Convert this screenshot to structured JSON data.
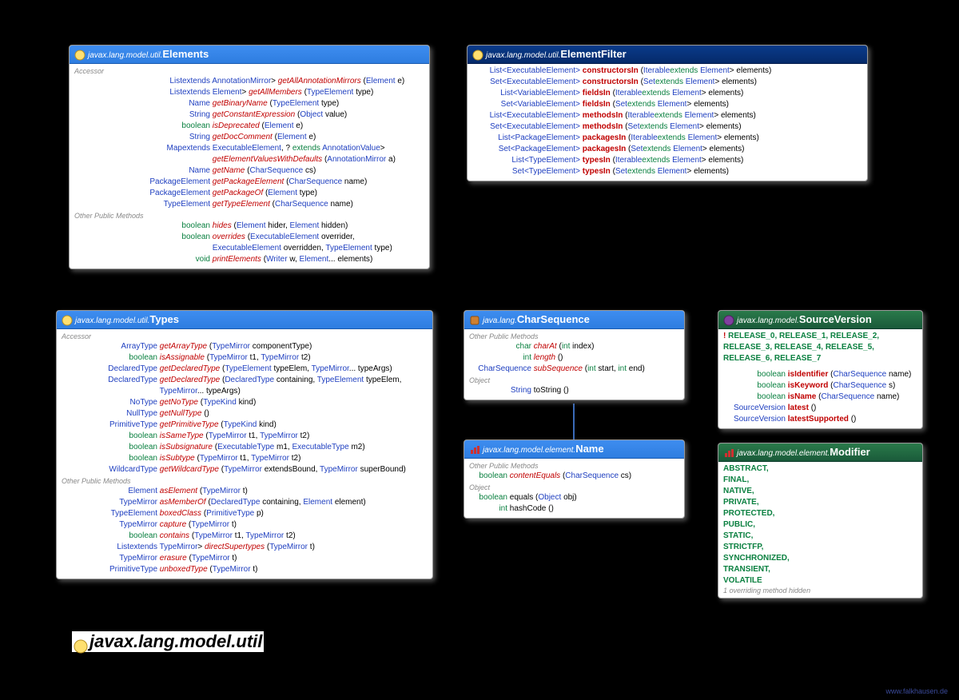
{
  "title": {
    "pkg": "javax.lang.model.util"
  },
  "credit": "www.falkhausen.de",
  "elements": {
    "pkg": "javax.lang.model.util.",
    "cls": "Elements",
    "sec1": "Accessor",
    "rows1": [
      {
        "ret": "List<? extends AnnotationMirror>",
        "mth": "getAllAnnotationMirrors",
        "args": "(Element e)"
      },
      {
        "ret": "List<? extends Element>",
        "mth": "getAllMembers",
        "args": "(TypeElement type)"
      },
      {
        "ret": "Name",
        "mth": "getBinaryName",
        "args": "(TypeElement type)"
      },
      {
        "ret": "String",
        "mth": "getConstantExpression",
        "args": "(Object value)"
      },
      {
        "ret": "boolean",
        "retkw": true,
        "mth": "isDeprecated",
        "args": "(Element e)"
      },
      {
        "ret": "String",
        "mth": "getDocComment",
        "args": "(Element e)"
      },
      {
        "ret": "Map<? extends ExecutableElement, ? extends AnnotationValue>",
        "mth": "",
        "args": ""
      },
      {
        "ret": "",
        "mth": "getElementValuesWithDefaults",
        "args": "(AnnotationMirror a)"
      },
      {
        "ret": "Name",
        "mth": "getName",
        "args": "(CharSequence cs)"
      },
      {
        "ret": "PackageElement",
        "mth": "getPackageElement",
        "args": "(CharSequence name)"
      },
      {
        "ret": "PackageElement",
        "mth": "getPackageOf",
        "args": "(Element type)"
      },
      {
        "ret": "TypeElement",
        "mth": "getTypeElement",
        "args": "(CharSequence name)"
      }
    ],
    "sec2": "Other Public Methods",
    "rows2": [
      {
        "ret": "boolean",
        "retkw": true,
        "mth": "hides",
        "args": "(Element hider, Element hidden)"
      },
      {
        "ret": "boolean",
        "retkw": true,
        "mth": "overrides",
        "args": "(ExecutableElement overrider,"
      },
      {
        "ret": "",
        "mth": "",
        "args": "ExecutableElement overridden, TypeElement type)"
      },
      {
        "ret": "void",
        "retkw": true,
        "mth": "printElements",
        "args": "(Writer w, Element... elements)"
      }
    ]
  },
  "filter": {
    "pkg": "javax.lang.model.util.",
    "cls": "ElementFilter",
    "rows": [
      {
        "ret": "List<ExecutableElement>",
        "mth": "constructorsIn",
        "args": "(Iterable<? extends Element> elements)"
      },
      {
        "ret": "Set<ExecutableElement>",
        "mth": "constructorsIn",
        "args": "(Set<? extends Element> elements)"
      },
      {
        "ret": "List<VariableElement>",
        "mth": "fieldsIn",
        "args": "(Iterable<? extends Element> elements)"
      },
      {
        "ret": "Set<VariableElement>",
        "mth": "fieldsIn",
        "args": "(Set<? extends Element> elements)"
      },
      {
        "ret": "List<ExecutableElement>",
        "mth": "methodsIn",
        "args": "(Iterable<? extends Element> elements)"
      },
      {
        "ret": "Set<ExecutableElement>",
        "mth": "methodsIn",
        "args": "(Set<? extends Element> elements)"
      },
      {
        "ret": "List<PackageElement>",
        "mth": "packagesIn",
        "args": "(Iterable<? extends Element> elements)"
      },
      {
        "ret": "Set<PackageElement>",
        "mth": "packagesIn",
        "args": "(Set<? extends Element> elements)"
      },
      {
        "ret": "List<TypeElement>",
        "mth": "typesIn",
        "args": "(Iterable<? extends Element> elements)"
      },
      {
        "ret": "Set<TypeElement>",
        "mth": "typesIn",
        "args": "(Set<? extends Element> elements)"
      }
    ]
  },
  "types": {
    "pkg": "javax.lang.model.util.",
    "cls": "Types",
    "sec1": "Accessor",
    "rows1": [
      {
        "ret": "ArrayType",
        "mth": "getArrayType",
        "args": "(TypeMirror componentType)"
      },
      {
        "ret": "boolean",
        "retkw": true,
        "mth": "isAssignable",
        "args": "(TypeMirror t1, TypeMirror t2)"
      },
      {
        "ret": "DeclaredType",
        "mth": "getDeclaredType",
        "args": "(TypeElement typeElem, TypeMirror... typeArgs)"
      },
      {
        "ret": "DeclaredType",
        "mth": "getDeclaredType",
        "args": "(DeclaredType containing, TypeElement typeElem,"
      },
      {
        "ret": "",
        "mth": "",
        "args": "TypeMirror... typeArgs)"
      },
      {
        "ret": "NoType",
        "mth": "getNoType",
        "args": "(TypeKind kind)"
      },
      {
        "ret": "NullType",
        "mth": "getNullType",
        "args": "()"
      },
      {
        "ret": "PrimitiveType",
        "mth": "getPrimitiveType",
        "args": "(TypeKind kind)"
      },
      {
        "ret": "boolean",
        "retkw": true,
        "mth": "isSameType",
        "args": "(TypeMirror t1, TypeMirror t2)"
      },
      {
        "ret": "boolean",
        "retkw": true,
        "mth": "isSubsignature",
        "args": "(ExecutableType m1, ExecutableType m2)"
      },
      {
        "ret": "boolean",
        "retkw": true,
        "mth": "isSubtype",
        "args": "(TypeMirror t1, TypeMirror t2)"
      },
      {
        "ret": "WildcardType",
        "mth": "getWildcardType",
        "args": "(TypeMirror extendsBound, TypeMirror superBound)"
      }
    ],
    "sec2": "Other Public Methods",
    "rows2": [
      {
        "ret": "Element",
        "mth": "asElement",
        "args": "(TypeMirror t)"
      },
      {
        "ret": "TypeMirror",
        "mth": "asMemberOf",
        "args": "(DeclaredType containing, Element element)"
      },
      {
        "ret": "TypeElement",
        "mth": "boxedClass",
        "args": "(PrimitiveType p)"
      },
      {
        "ret": "TypeMirror",
        "mth": "capture",
        "args": "(TypeMirror t)"
      },
      {
        "ret": "boolean",
        "retkw": true,
        "mth": "contains",
        "args": "(TypeMirror t1, TypeMirror t2)"
      },
      {
        "ret": "List<? extends TypeMirror>",
        "mth": "directSupertypes",
        "args": "(TypeMirror t)"
      },
      {
        "ret": "TypeMirror",
        "mth": "erasure",
        "args": "(TypeMirror t)"
      },
      {
        "ret": "PrimitiveType",
        "mth": "unboxedType",
        "args": "(TypeMirror t)"
      }
    ]
  },
  "charseq": {
    "pkg": "java.lang.",
    "cls": "CharSequence",
    "sec1": "Other Public Methods",
    "rows1": [
      {
        "ret": "char",
        "retkw": true,
        "mth": "charAt",
        "args": "(int index)"
      },
      {
        "ret": "int",
        "retkw": true,
        "mth": "length",
        "args": "()"
      },
      {
        "ret": "CharSequence",
        "mth": "subSequence",
        "args": "(int start, int end)"
      }
    ],
    "sec2": "Object",
    "rows2": [
      {
        "ret": "String",
        "mth": "toString",
        "plain": true,
        "args": "()"
      }
    ]
  },
  "name": {
    "pkg": "javax.lang.model.element.",
    "cls": "Name",
    "sec1": "Other Public Methods",
    "rows1": [
      {
        "ret": "boolean",
        "retkw": true,
        "mth": "contentEquals",
        "args": "(CharSequence cs)"
      }
    ],
    "sec2": "Object",
    "rows2": [
      {
        "ret": "boolean",
        "retkw": true,
        "mth": "equals",
        "plain": true,
        "args": "(Object obj)"
      },
      {
        "ret": "int",
        "retkw": true,
        "mth": "hashCode",
        "plain": true,
        "args": "()"
      }
    ]
  },
  "sv": {
    "pkg": "javax.lang.model.",
    "cls": "SourceVersion",
    "consts": "RELEASE_0, RELEASE_1, RELEASE_2, RELEASE_3, RELEASE_4, RELEASE_5, RELEASE_6, RELEASE_7",
    "rows": [
      {
        "ret": "boolean",
        "retkw": true,
        "mth": "isIdentifier",
        "args": "(CharSequence name)"
      },
      {
        "ret": "boolean",
        "retkw": true,
        "mth": "isKeyword",
        "args": "(CharSequence s)"
      },
      {
        "ret": "boolean",
        "retkw": true,
        "mth": "isName",
        "args": "(CharSequence name)"
      },
      {
        "ret": "SourceVersion",
        "mth": "latest",
        "args": "()"
      },
      {
        "ret": "SourceVersion",
        "mth": "latestSupported",
        "args": "()"
      }
    ]
  },
  "mod": {
    "pkg": "javax.lang.model.element.",
    "cls": "Modifier",
    "consts": [
      "ABSTRACT,",
      "FINAL,",
      "NATIVE,",
      "PRIVATE,",
      "PROTECTED,",
      "PUBLIC,",
      "STATIC,",
      "STRICTFP,",
      "SYNCHRONIZED,",
      "TRANSIENT,",
      "VOLATILE"
    ],
    "note": "1 overriding method hidden"
  }
}
